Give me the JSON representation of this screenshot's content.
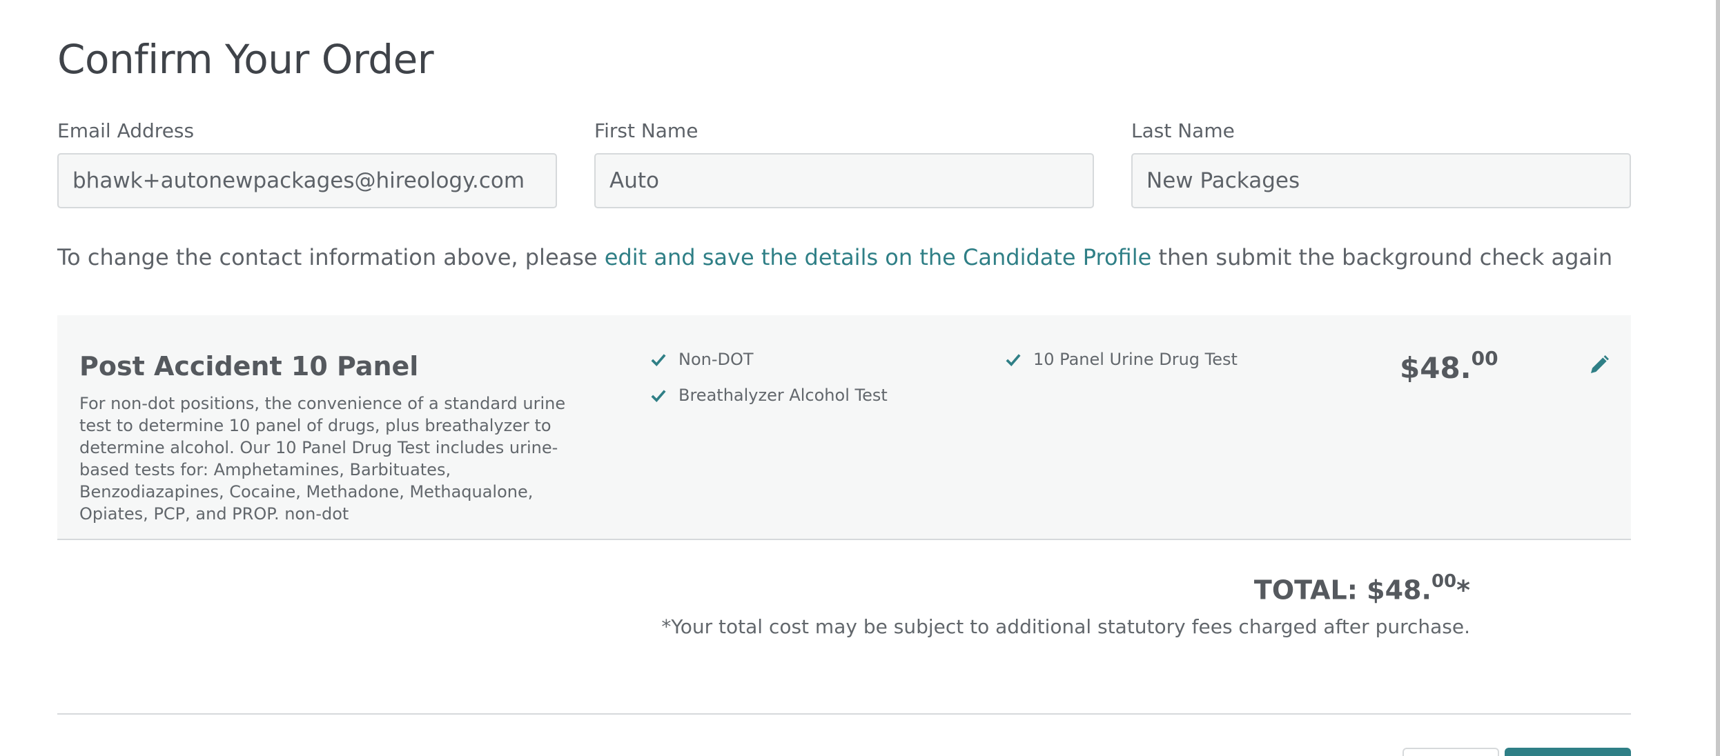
{
  "page_title": "Confirm Your Order",
  "contact": {
    "email": {
      "label": "Email Address",
      "value": "bhawk+autonewpackages@hireology.com"
    },
    "first_name": {
      "label": "First Name",
      "value": "Auto"
    },
    "last_name": {
      "label": "Last Name",
      "value": "New Packages"
    }
  },
  "note": {
    "before": "To change the contact information above, please ",
    "link": "edit and save the details on the Candidate Profile",
    "after": " then submit the background check again"
  },
  "package": {
    "name": "Post Accident 10 Panel",
    "description": "For non-dot positions, the convenience of a standard urine test to determine 10 panel of drugs, plus breathalyzer to determine alcohol. Our 10 Panel Drug Test includes urine-based tests for: Amphetamines, Barbituates, Benzodiazapines, Cocaine, Methadone, Methaqualone, Opiates, PCP, and PROP. non-dot",
    "features": [
      "Non-DOT",
      "Breathalyzer Alcohol Test",
      "10 Panel Urine Drug Test"
    ],
    "price_whole": "$48.",
    "price_cents": "00"
  },
  "total": {
    "label": "TOTAL: $48.",
    "cents": "00",
    "asterisk": "*",
    "disclaimer": "*Your total cost may be subject to additional statutory fees charged after purchase."
  },
  "colors": {
    "accent": "#2f7f86",
    "text": "#5d6268",
    "panel_bg": "#f6f7f7",
    "border": "#d6d9db"
  },
  "icons": {
    "check": "check-icon",
    "edit": "pencil-icon"
  }
}
